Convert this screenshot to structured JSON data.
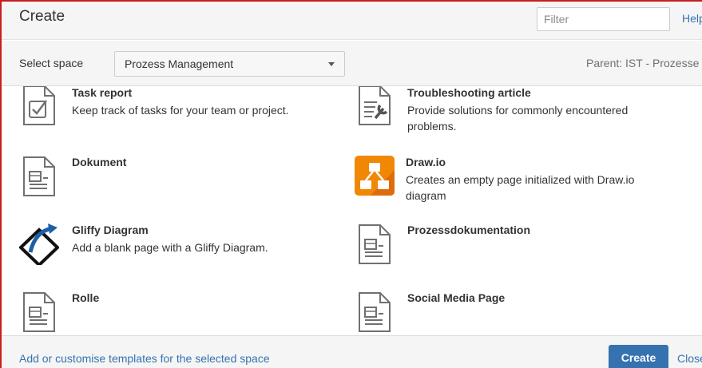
{
  "header": {
    "title": "Create",
    "filter_placeholder": "Filter",
    "help_label": "Help"
  },
  "space_bar": {
    "label": "Select space",
    "selected_space": "Prozess Management",
    "parent_text": "Parent: IST - Prozesse"
  },
  "templates": [
    {
      "title": "Task report",
      "description": "Keep track of tasks for your team or project.",
      "icon": "task-report-icon"
    },
    {
      "title": "Troubleshooting article",
      "description": "Provide solutions for commonly encountered problems.",
      "icon": "troubleshooting-icon"
    },
    {
      "title": "Dokument",
      "description": "",
      "icon": "document-icon"
    },
    {
      "title": "Draw.io",
      "description": "Creates an empty page initialized with Draw.io diagram",
      "icon": "drawio-icon"
    },
    {
      "title": "Gliffy Diagram",
      "description": "Add a blank page with a Gliffy Diagram.",
      "icon": "gliffy-icon"
    },
    {
      "title": "Prozessdokumentation",
      "description": "",
      "icon": "document-icon"
    },
    {
      "title": "Rolle",
      "description": "",
      "icon": "document-icon"
    },
    {
      "title": "Social Media Page",
      "description": "",
      "icon": "document-icon"
    }
  ],
  "footer": {
    "templates_link": "Add or customise templates for the selected space",
    "create_label": "Create",
    "close_label": "Close"
  },
  "colors": {
    "accent": "#3572b0",
    "frame_border": "#c81e1e",
    "drawio_orange": "#f08705"
  }
}
